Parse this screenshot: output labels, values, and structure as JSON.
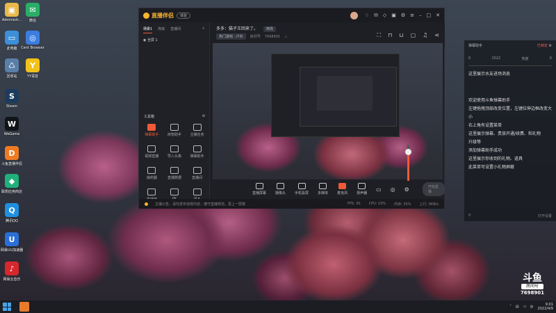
{
  "desktop": {
    "icons": [
      {
        "label": "Administr...",
        "icon": "user-folder-icon",
        "color": "#e9b949",
        "glyph": "▣"
      },
      {
        "label": "微信",
        "icon": "wechat-icon",
        "color": "#2aae67",
        "glyph": "✉"
      },
      {
        "label": "此电脑",
        "icon": "computer-icon",
        "color": "#3c8fd8",
        "glyph": "▭"
      },
      {
        "label": "Cent Browser",
        "icon": "browser-icon",
        "color": "#3b7de0",
        "glyph": "◎"
      },
      {
        "label": "回收站",
        "icon": "recycle-bin-icon",
        "color": "#5a7fa8",
        "glyph": "♺"
      },
      {
        "label": "YY语音",
        "icon": "yy-icon",
        "color": "#f2c21b",
        "glyph": "Y"
      },
      {
        "label": "Steam",
        "icon": "steam-icon",
        "color": "#1d3b5c",
        "glyph": "S"
      },
      {
        "label": "WeGame",
        "icon": "wegame-icon",
        "color": "#101418",
        "glyph": "W"
      },
      {
        "label": "斗鱼直播伴侣",
        "icon": "douyu-companion-icon",
        "color": "#f07a22",
        "glyph": "D"
      },
      {
        "label": "联想应用商店",
        "icon": "app-store-icon",
        "color": "#20b07a",
        "glyph": "◆"
      },
      {
        "label": "腾讯QQ",
        "icon": "qq-icon",
        "color": "#1f8fe0",
        "glyph": "Q"
      },
      {
        "label": "网易UU加速器",
        "icon": "uu-accelerator-icon",
        "color": "#2a6fd6",
        "glyph": "U"
      },
      {
        "label": "网易云音乐",
        "icon": "netease-music-icon",
        "color": "#d6282c",
        "glyph": "♪"
      }
    ]
  },
  "app": {
    "name": "直播伴侣",
    "version_badge": "体验",
    "window_controls": [
      "avatar",
      "shirt-icon",
      "mail-icon",
      "skin-icon",
      "gift-icon",
      "settings-icon",
      "menu-icon",
      "minimize-icon",
      "maximize-icon",
      "close-icon"
    ],
    "left_tabs": [
      "场景1",
      "高级",
      "直播间"
    ],
    "scene_item": "全屏 1",
    "tools_title": "工具箱",
    "tools": [
      {
        "label": "弹幕助手",
        "hot": true
      },
      {
        "label": "房管助手",
        "hot": false
      },
      {
        "label": "主播任务",
        "hot": false
      },
      {
        "label": "视频直播",
        "hot": false
      },
      {
        "label": "导入头像",
        "hot": false
      },
      {
        "label": "弹幕助手",
        "hot": false
      },
      {
        "label": "抽奖器",
        "hot": false
      },
      {
        "label": "直播数据",
        "hot": false
      },
      {
        "label": "直播间",
        "hot": false
      },
      {
        "label": "直播榜",
        "hot": false
      },
      {
        "label": "PK",
        "hot": false
      },
      {
        "label": "更多",
        "hot": false
      }
    ],
    "header": {
      "title_line": "多多：猫子王回来了。",
      "edit_label": "修改",
      "category": "热门游戏 · 户外",
      "room_label": "房间号",
      "room_no": "7698901"
    },
    "header_icons": [
      "fullscreen-icon",
      "lock-icon",
      "unlock-icon",
      "chat-icon",
      "bell-icon",
      "share-icon"
    ],
    "volume_level": 0.78,
    "bottom_buttons": [
      {
        "label": "直播屏幕",
        "icon": "screen-icon",
        "hot": false
      },
      {
        "label": "摄像头",
        "icon": "camera-icon",
        "hot": false
      },
      {
        "label": "手机投屏",
        "icon": "phone-icon",
        "hot": false
      },
      {
        "label": "多媒体",
        "icon": "media-icon",
        "hot": false
      },
      {
        "label": "麦克风",
        "icon": "mic-icon",
        "hot": true
      },
      {
        "label": "扬声器",
        "icon": "speaker-icon",
        "hot": false
      }
    ],
    "start_button": "开始直播",
    "status": {
      "notice": "主播公告，请勿发布违规内容，遵守直播规范，更上一层楼",
      "stats": [
        "FPS: 30",
        "CPU: 10%",
        "内存: 35%",
        "上行: 0KB/s"
      ]
    }
  },
  "danmu_panel": {
    "title": "弹幕助手",
    "lock_label": "已锁定",
    "stats": [
      "0",
      "2022",
      "热度",
      "0"
    ],
    "messages": [
      "这里展示水友进场消息",
      "欢迎使用斗鱼弹幕助手",
      "左键拖拽顶部改变位置，左键拉伸边框改变大小",
      "右上角有设置菜单",
      "这里展示弹幕、贵族开通/续费、和礼物",
      "升级等",
      "添加弹幕助手成功",
      "这里展示你收到的礼物、道具",
      "此菜单可设置小礼物屏蔽"
    ],
    "footer_left": "0",
    "footer_right": "打开设置"
  },
  "brand": {
    "name": "斗鱼",
    "room_label": "房间号",
    "room_no": "7698901"
  },
  "taskbar": {
    "time": "9:01",
    "date": "2022/4/9",
    "tray_icons": [
      "up-arrow-icon",
      "network-icon",
      "volume-icon",
      "ime-icon"
    ]
  }
}
